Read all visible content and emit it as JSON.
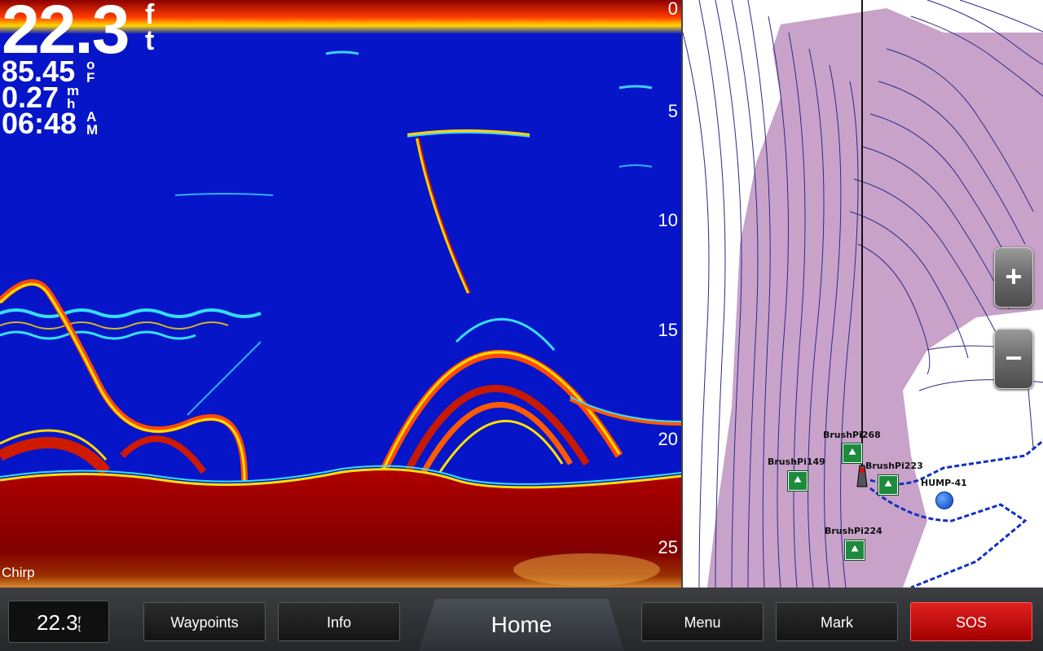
{
  "sonar": {
    "depth_value": "22.3",
    "depth_unit": [
      "f",
      "t"
    ],
    "water_temp": "85.45",
    "water_temp_unit": [
      "o",
      "F"
    ],
    "speed": "0.27",
    "speed_unit": [
      "m",
      "h"
    ],
    "time": "06:48",
    "time_unit": [
      "A",
      "M"
    ],
    "mode_label": "Chirp",
    "depth_scale": [
      "0",
      "5",
      "10",
      "15",
      "20",
      "25"
    ]
  },
  "map": {
    "waypoints": [
      {
        "name": "BrushPi268"
      },
      {
        "name": "BrushPi149"
      },
      {
        "name": "BrushPi223"
      },
      {
        "name": "HUMP-41"
      },
      {
        "name": "BrushPi224"
      }
    ],
    "zoom_in_symbol": "+",
    "zoom_out_symbol": "−",
    "waypoint_symbol": "⯅"
  },
  "footer": {
    "depth_value": "22.3",
    "depth_unit": [
      "f",
      "t"
    ],
    "waypoints_label": "Waypoints",
    "info_label": "Info",
    "home_label": "Home",
    "menu_label": "Menu",
    "mark_label": "Mark",
    "sos_label": "SOS"
  },
  "colors": {
    "sonar_water": "#0615c8",
    "sonar_bottom": "#8b0000",
    "map_shallow": "#c8a2c8",
    "sos": "#d00000"
  }
}
